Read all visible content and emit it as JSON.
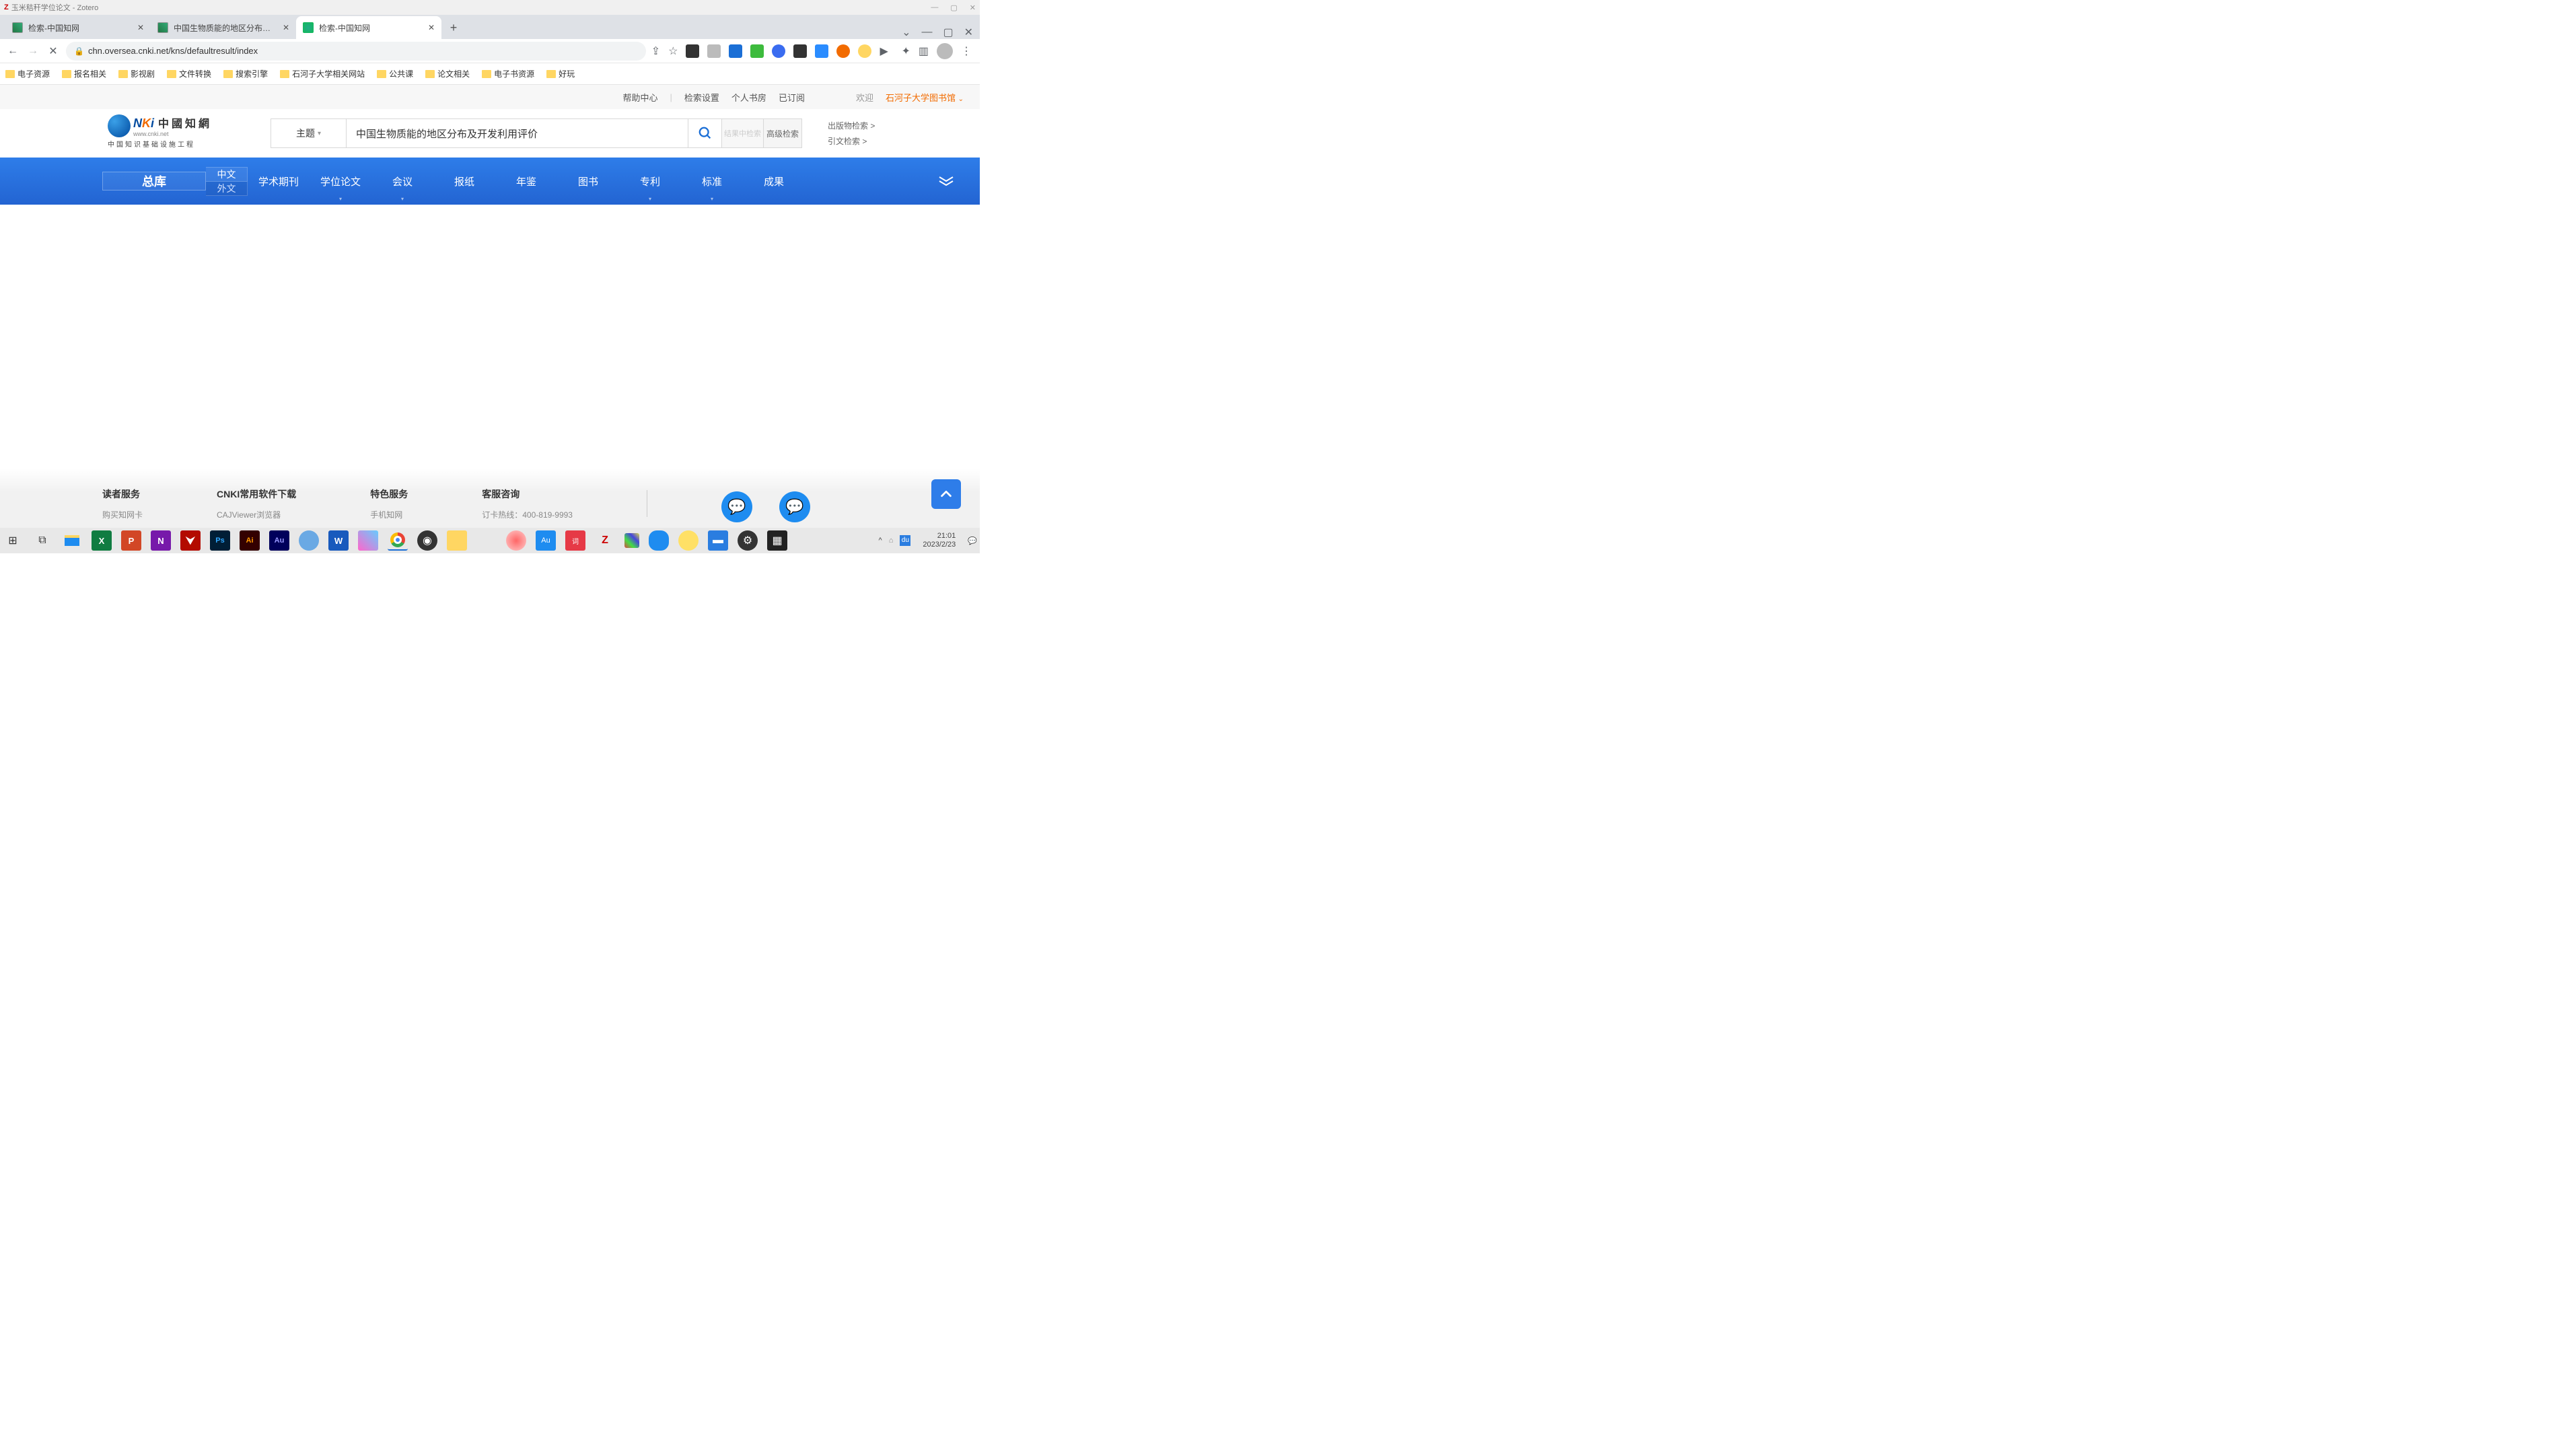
{
  "os_window": {
    "title": "玉米秸秆学位论文 - Zotero",
    "controls": [
      "—",
      "▢",
      "✕"
    ]
  },
  "browser": {
    "tabs": [
      {
        "title": "检索-中国知网"
      },
      {
        "title": "中国生物质能的地区分布及开发利"
      },
      {
        "title": "检索-中国知网"
      }
    ],
    "active_tab_index": 2,
    "address": "chn.oversea.cnki.net/kns/defaultresult/index",
    "bookmarks": [
      "电子资源",
      "报名相关",
      "影视剧",
      "文件转换",
      "搜索引擎",
      "石河子大学相关网站",
      "公共课",
      "论文相关",
      "电子书资源",
      "好玩"
    ]
  },
  "cnki_top": {
    "links": [
      "帮助中心",
      "检索设置",
      "个人书房",
      "已订阅"
    ],
    "welcome": "欢迎",
    "library": "石河子大学图书馆"
  },
  "cnki_logo": {
    "cn": "中國知網",
    "url": "www.cnki.net",
    "sub": "中国知识基础设施工程"
  },
  "search": {
    "type": "主题",
    "value": "中国生物质能的地区分布及开发利用评价",
    "secondary": "结果中检索",
    "advanced": "高级检索",
    "extra1": "出版物检索  >",
    "extra2": "引文检索  >"
  },
  "categories": {
    "main": "总库",
    "lang_cn": "中文",
    "lang_en": "外文",
    "items": [
      "学术期刊",
      "学位论文",
      "会议",
      "报纸",
      "年鉴",
      "图书",
      "专利",
      "标准",
      "成果"
    ]
  },
  "footer": {
    "col1_h": "读者服务",
    "col1_link": "购买知网卡",
    "col2_h": "CNKI常用软件下载",
    "col2_link": "CAJViewer浏览器",
    "col3_h": "特色服务",
    "col3_link": "手机知网",
    "col4_h": "客服咨询",
    "col4_link": "订卡热线：400-819-9993"
  },
  "system": {
    "time": "21:01",
    "date": "2023/2/23"
  }
}
